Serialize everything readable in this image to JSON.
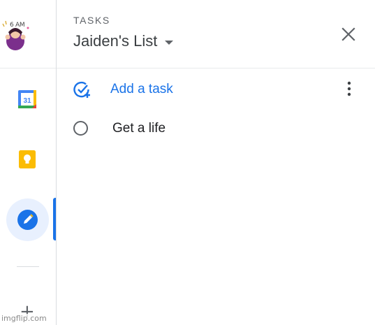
{
  "rail": {
    "avatar_text": "6 AM",
    "watermark": "imgflip.com",
    "colors": {
      "calendar_blue": "#4285f4",
      "keep_yellow": "#fbbc04",
      "tasks_blue": "#1a73e8"
    },
    "items": [
      {
        "name": "calendar",
        "icon": "calendar-icon",
        "day": "31"
      },
      {
        "name": "keep",
        "icon": "lightbulb-icon"
      },
      {
        "name": "tasks",
        "icon": "tasks-icon",
        "active": true
      },
      {
        "name": "add-app",
        "icon": "plus-icon",
        "glyph": "+"
      }
    ]
  },
  "header": {
    "section_label": "TASKS",
    "list_name": "Jaiden's List",
    "list_dropdown_icon": "caret-down-icon",
    "close_icon": "close-icon"
  },
  "toolbar": {
    "add_task_label": "Add a task",
    "add_task_icon": "add-task-icon",
    "more_icon": "more-vert-icon"
  },
  "tasks": [
    {
      "title": "Get a life",
      "completed": false
    }
  ]
}
